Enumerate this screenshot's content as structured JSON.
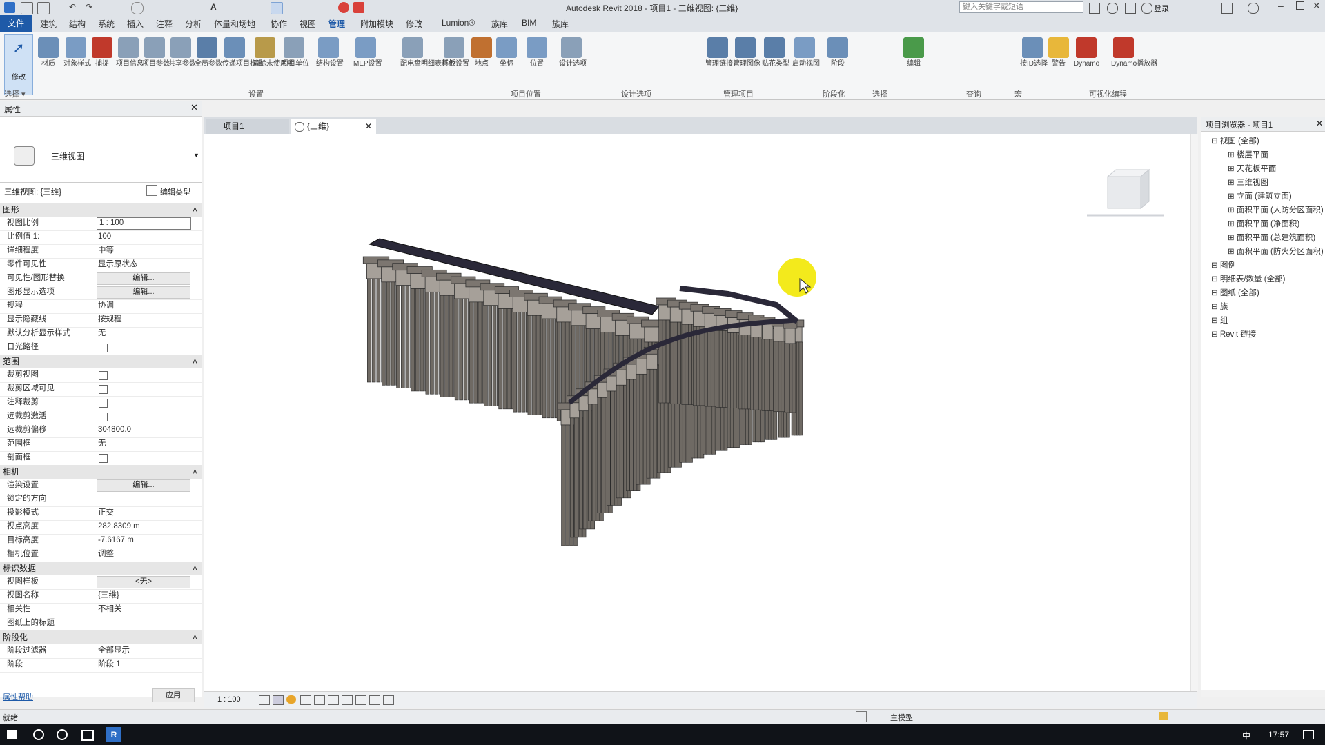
{
  "title_bar": {
    "app_title": "Autodesk Revit 2018 - 项目1 - 三维视图: {三维}",
    "search_placeholder": "键入关键字或短语",
    "user_label": "登录"
  },
  "menu": {
    "file": "文件",
    "tabs": [
      "建筑",
      "结构",
      "系统",
      "插入",
      "注释",
      "分析",
      "体量和场地",
      "协作",
      "视图",
      "管理",
      "附加模块",
      "修改",
      "Lumion®",
      "族库",
      "BIM",
      "族库"
    ]
  },
  "ribbon": {
    "modify_label": "修改",
    "select_label": "选择 ▾",
    "buttons": [
      {
        "label": "材质",
        "icon": "material-icon"
      },
      {
        "label": "对象样式",
        "icon": "object-style-icon"
      },
      {
        "label": "捕捉",
        "icon": "snap-icon"
      },
      {
        "label": "项目信息",
        "icon": "project-info-icon"
      },
      {
        "label": "项目参数",
        "icon": "project-params-icon"
      },
      {
        "label": "共享参数",
        "icon": "shared-params-icon"
      },
      {
        "label": "全局参数",
        "icon": "global-params-icon"
      },
      {
        "label": "传递项目标准",
        "icon": "transfer-icon"
      },
      {
        "label": "清除未使用项",
        "icon": "purge-icon"
      },
      {
        "label": "项目单位",
        "icon": "units-icon"
      },
      {
        "label": "结构设置",
        "icon": "structural-settings-icon"
      },
      {
        "label": "MEP设置",
        "icon": "mep-settings-icon"
      },
      {
        "label": "配电盘明细表样板",
        "icon": "panel-schedule-icon"
      },
      {
        "label": "其他设置",
        "icon": "other-settings-icon"
      },
      {
        "label": "地点",
        "icon": "location-icon"
      },
      {
        "label": "坐标",
        "icon": "coordinates-icon"
      },
      {
        "label": "位置",
        "icon": "position-icon"
      },
      {
        "label": "设计选项",
        "icon": "design-options-icon"
      },
      {
        "label": "管理链接",
        "icon": "manage-links-icon"
      },
      {
        "label": "管理图像",
        "icon": "manage-images-icon"
      },
      {
        "label": "贴花类型",
        "icon": "decal-icon"
      },
      {
        "label": "启动视图",
        "icon": "startup-view-icon"
      },
      {
        "label": "阶段",
        "icon": "phases-icon"
      },
      {
        "label": "编辑",
        "icon": "edit-icon"
      },
      {
        "label": "按ID选择",
        "icon": "select-by-id-icon"
      },
      {
        "label": "警告",
        "icon": "warning-icon"
      },
      {
        "label": "Dynamo",
        "icon": "dynamo-icon"
      },
      {
        "label": "Dynamo播放器",
        "icon": "dynamo-player-icon"
      }
    ],
    "panels": [
      "选择",
      "设置",
      "项目位置",
      "设计选项",
      "管理项目",
      "阶段化",
      "选择",
      "查询",
      "宏",
      "可视化编程"
    ]
  },
  "properties": {
    "panel_title": "属性",
    "type_name": "三维视图",
    "instance_label": "三维视图: {三维}",
    "edit_type": "编辑类型",
    "groups": {
      "graphics": "图形",
      "extents": "范围",
      "camera": "相机",
      "identity": "标识数据",
      "phasing": "阶段化"
    },
    "rows_graphics": [
      {
        "k": "视图比例",
        "v": "1 : 100",
        "kind": "input"
      },
      {
        "k": "比例值 1:",
        "v": "100",
        "kind": "text"
      },
      {
        "k": "详细程度",
        "v": "中等",
        "kind": "text"
      },
      {
        "k": "零件可见性",
        "v": "显示原状态",
        "kind": "text"
      },
      {
        "k": "可见性/图形替换",
        "v": "编辑...",
        "kind": "button"
      },
      {
        "k": "图形显示选项",
        "v": "编辑...",
        "kind": "button"
      },
      {
        "k": "规程",
        "v": "协调",
        "kind": "text"
      },
      {
        "k": "显示隐藏线",
        "v": "按规程",
        "kind": "text"
      },
      {
        "k": "默认分析显示样式",
        "v": "无",
        "kind": "text"
      },
      {
        "k": "日光路径",
        "v": "",
        "kind": "check"
      }
    ],
    "rows_extents": [
      {
        "k": "裁剪视图",
        "v": "",
        "kind": "check"
      },
      {
        "k": "裁剪区域可见",
        "v": "",
        "kind": "check"
      },
      {
        "k": "注释裁剪",
        "v": "",
        "kind": "check"
      },
      {
        "k": "远裁剪激活",
        "v": "",
        "kind": "check"
      },
      {
        "k": "远裁剪偏移",
        "v": "304800.0",
        "kind": "text"
      },
      {
        "k": "范围框",
        "v": "无",
        "kind": "text"
      },
      {
        "k": "剖面框",
        "v": "",
        "kind": "check"
      }
    ],
    "rows_camera": [
      {
        "k": "渲染设置",
        "v": "编辑...",
        "kind": "button"
      },
      {
        "k": "锁定的方向",
        "v": "",
        "kind": "text"
      },
      {
        "k": "投影模式",
        "v": "正交",
        "kind": "text"
      },
      {
        "k": "视点高度",
        "v": "282.8309 m",
        "kind": "text"
      },
      {
        "k": "目标高度",
        "v": "-7.6167 m",
        "kind": "text"
      },
      {
        "k": "相机位置",
        "v": "调整",
        "kind": "text"
      }
    ],
    "rows_identity": [
      {
        "k": "视图样板",
        "v": "<无>",
        "kind": "button"
      },
      {
        "k": "视图名称",
        "v": "{三维}",
        "kind": "text"
      },
      {
        "k": "相关性",
        "v": "不相关",
        "kind": "text"
      },
      {
        "k": "图纸上的标题",
        "v": "",
        "kind": "text"
      }
    ],
    "rows_phasing": [
      {
        "k": "阶段过滤器",
        "v": "全部显示",
        "kind": "text"
      },
      {
        "k": "阶段",
        "v": "阶段 1",
        "kind": "text"
      }
    ],
    "help_link": "属性帮助",
    "apply": "应用"
  },
  "doc_tabs": [
    {
      "label": "项目1",
      "active": false
    },
    {
      "label": "{三维}",
      "active": true
    }
  ],
  "browser": {
    "title": "项目浏览器 - 项目1",
    "items": [
      {
        "label": "视图 (全部)",
        "level": 0
      },
      {
        "label": "楼层平面",
        "level": 1
      },
      {
        "label": "天花板平面",
        "level": 1
      },
      {
        "label": "三维视图",
        "level": 1
      },
      {
        "label": "立面 (建筑立面)",
        "level": 1
      },
      {
        "label": "面积平面 (人防分区面积)",
        "level": 1
      },
      {
        "label": "面积平面 (净面积)",
        "level": 1
      },
      {
        "label": "面积平面 (总建筑面积)",
        "level": 1
      },
      {
        "label": "面积平面 (防火分区面积)",
        "level": 1
      },
      {
        "label": "图例",
        "level": 0
      },
      {
        "label": "明细表/数量 (全部)",
        "level": 0
      },
      {
        "label": "图纸 (全部)",
        "level": 0
      },
      {
        "label": "族",
        "level": 0
      },
      {
        "label": "组",
        "level": 0
      },
      {
        "label": "Revit 链接",
        "level": 0
      }
    ]
  },
  "view_controls": {
    "scale": "1 : 100"
  },
  "status": {
    "left": "就绪",
    "model": "主模型"
  },
  "taskbar": {
    "time": "17:57",
    "ime": "中"
  }
}
